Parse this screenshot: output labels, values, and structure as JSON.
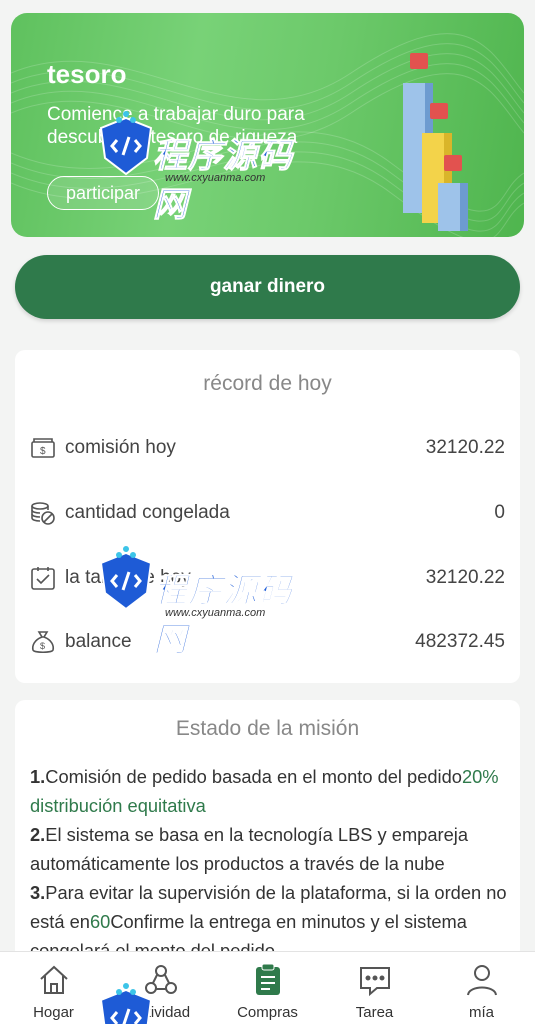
{
  "banner": {
    "title": "tesoro",
    "subtitle": "Comience a trabajar duro para descubrir el tesoro de riqueza",
    "button_label": "participar"
  },
  "earn_button_label": "ganar dinero",
  "record": {
    "title": "récord de hoy",
    "rows": [
      {
        "icon": "cash-icon",
        "label": "comisión hoy",
        "value": "32120.22"
      },
      {
        "icon": "coins-frozen-icon",
        "label": "cantidad congelada",
        "value": "0"
      },
      {
        "icon": "checklist-icon",
        "label": "la tarea de hoy",
        "value": "32120.22"
      },
      {
        "icon": "money-bag-icon",
        "label": "balance",
        "value": "482372.45"
      }
    ]
  },
  "mission": {
    "title": "Estado de la misión",
    "items": [
      {
        "num": "1.",
        "text": "Comisión de pedido basada en el monto del pedido",
        "highlight": "20% distribución equitativa",
        "after": ""
      },
      {
        "num": "2.",
        "text": "El sistema se basa en la tecnología LBS y empareja automáticamente los productos a través de la nube",
        "highlight": "",
        "after": ""
      },
      {
        "num": "3.",
        "text": "Para evitar la supervisión de la plataforma, si la orden no está en",
        "highlight": "60",
        "after": "Confirme la entrega en minutos y el sistema congelará el monto del pedido"
      }
    ]
  },
  "nav": [
    {
      "icon": "home-icon",
      "label": "Hogar"
    },
    {
      "icon": "activity-icon",
      "label": "actividad"
    },
    {
      "icon": "orders-icon",
      "label": "Compras"
    },
    {
      "icon": "chat-icon",
      "label": "Tarea"
    },
    {
      "icon": "user-icon",
      "label": "mía"
    }
  ],
  "watermark": {
    "text": "程序源码网",
    "url": "www.cxyuanma.com"
  },
  "colors": {
    "primary": "#2f7a4b",
    "banner_green": "#6cc96a",
    "background": "#f3f4f3"
  }
}
